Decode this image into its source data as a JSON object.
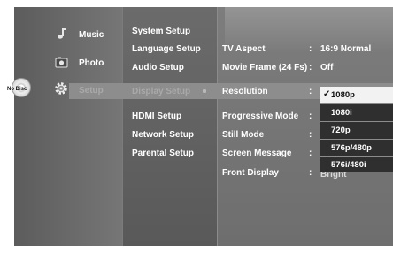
{
  "left_menu": {
    "items": [
      {
        "label": "Music",
        "icon": "music-note-icon"
      },
      {
        "label": "Photo",
        "icon": "photo-icon"
      },
      {
        "label": "Setup",
        "icon": "gear-icon"
      }
    ],
    "disc_status": "No Disc"
  },
  "setup_menu": {
    "items": [
      "System Setup",
      "Language Setup",
      "Audio Setup",
      "Display Setup",
      "HDMI Setup",
      "Network Setup",
      "Parental Setup"
    ],
    "selected": "Display Setup"
  },
  "display_settings": {
    "rows": [
      {
        "label": "TV Aspect",
        "value": "16:9 Normal"
      },
      {
        "label": "Movie Frame (24 Fs)",
        "value": "Off"
      },
      {
        "label": "Resolution",
        "value": ""
      },
      {
        "label": "Progressive Mode",
        "value": ""
      },
      {
        "label": "Still Mode",
        "value": ""
      },
      {
        "label": "Screen Message",
        "value": ""
      },
      {
        "label": "Front Display",
        "value": "Bright"
      }
    ],
    "colon": ":"
  },
  "resolution_dropdown": {
    "options": [
      "1080p",
      "1080i",
      "720p",
      "576p/480p",
      "576i/480i"
    ],
    "selected": "1080p",
    "check_mark": "✓"
  },
  "colors": {
    "highlight": "#8d8d8d",
    "dropdown_bg": "#2f2f2f",
    "selected_option_bg": "#f2f2f2"
  }
}
